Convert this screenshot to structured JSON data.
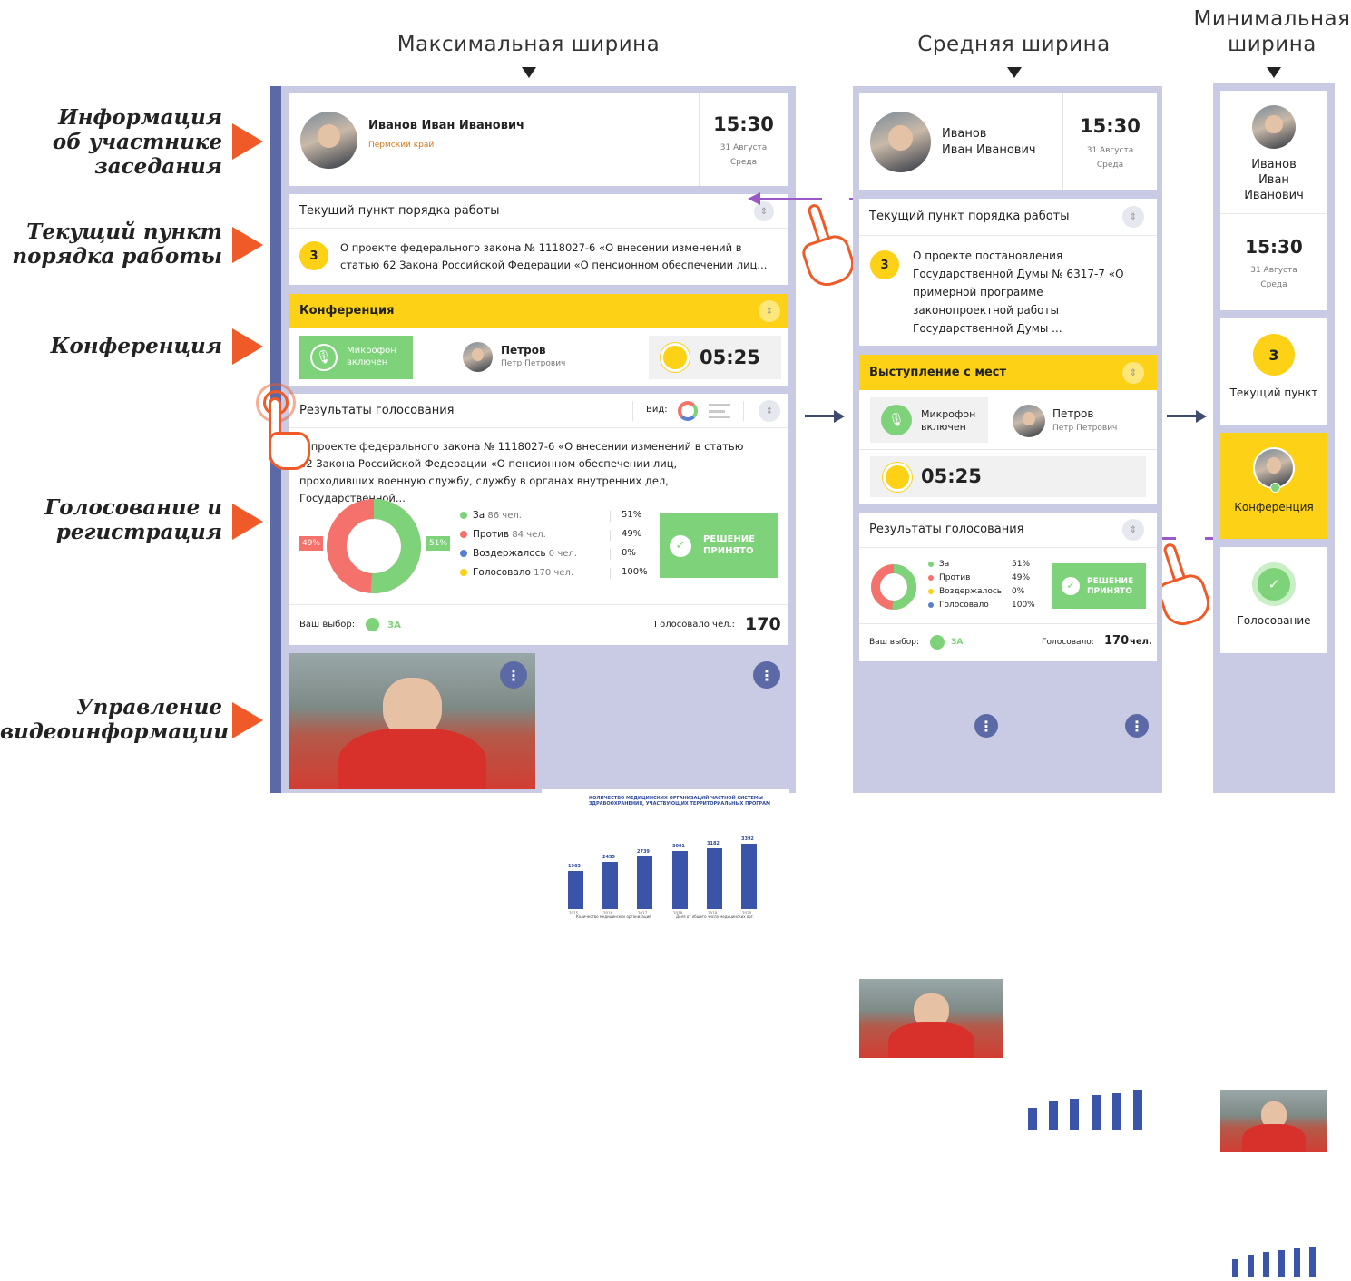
{
  "headers": {
    "max": "Максимальная ширина",
    "mid": "Средняя ширина",
    "min_line1": "Минимальная",
    "min_line2": "ширина"
  },
  "side_labels": {
    "participant": [
      "Информация",
      "об участнике",
      "заседания"
    ],
    "agenda": [
      "Текущий пункт",
      "порядка работы"
    ],
    "conference": [
      "Конференция"
    ],
    "voting": [
      "Голосование и",
      "регистрация"
    ],
    "video": [
      "Управление",
      "видеоинформации"
    ]
  },
  "participant": {
    "full_name": "Иванов Иван Иванович",
    "surname": "Иванов",
    "given": "Иван Иванович",
    "given1": "Иван",
    "given2": "Иванович",
    "region": "Пермский край",
    "time": "15:30",
    "date": "31 Августа",
    "weekday": "Среда"
  },
  "agenda": {
    "title": "Текущий пункт порядка работы",
    "number": "3",
    "text_max": "О проекте федерального закона № 1118027-6 «О внесении изменений в статью 62 Закона Российской Федерации «О пенсионном обеспечении лиц...",
    "text_mid": "О проекте постановления Государственной Думы № 6317-7 «О примерной программе законопроектной работы Государственной Думы ...",
    "short_label": "Текущий пункт"
  },
  "conference": {
    "title_max": "Конференция",
    "title_mid": "Выступление с мест",
    "mic_line1": "Микрофон",
    "mic_line2": "включен",
    "speaker_surname": "Петров",
    "speaker_given": "Петр Петрович",
    "timer": "05:25",
    "short_label": "Конференция"
  },
  "voting": {
    "title": "Результаты голосования",
    "view_label": "Вид:",
    "text": "О проекте федерального закона № 1118027-6 «О внесении изменений в статью 62 Закона Российской Федерации «О пенсионном обеспечении лиц, проходивших военную службу, службу в органах внутренних дел, Государственной...",
    "rows": [
      {
        "label": "За",
        "count": "86",
        "unit": "чел.",
        "pct": "51%",
        "color": "#7ed27a"
      },
      {
        "label": "Против",
        "count": "84",
        "unit": "чел.",
        "pct": "49%",
        "color": "#f4726b"
      },
      {
        "label": "Воздержалось",
        "count": "0",
        "unit": "чел.",
        "pct": "0%",
        "color": "#5b7fd0"
      },
      {
        "label": "Голосовало",
        "count": "170",
        "unit": "чел.",
        "pct": "100%",
        "color": "#fcd116"
      }
    ],
    "mid_rows": [
      {
        "label": "За",
        "pct": "51%",
        "color": "#7ed27a"
      },
      {
        "label": "Против",
        "pct": "49%",
        "color": "#f4726b"
      },
      {
        "label": "Воздержалось",
        "pct": "0%",
        "color": "#fcd116"
      },
      {
        "label": "Голосовало",
        "pct": "100%",
        "color": "#5b7fd0"
      }
    ],
    "donut_for_pct": 51,
    "badge_for": "51%",
    "badge_against": "49%",
    "decision_line1": "РЕШЕНИЕ",
    "decision_line2": "ПРИНЯТО",
    "your_choice_label": "Ваш выбор:",
    "your_choice_value": "ЗА",
    "voted_label_max": "Голосовало чел.:",
    "voted_label_mid": "Голосовало:",
    "voted_total": "170",
    "voted_unit": "чел.",
    "short_label": "Голосование"
  },
  "video": {
    "kebab": "⋮",
    "chart_title_line1": "КОЛИЧЕСТВО МЕДИЦИНСКИХ ОРГАНИЗАЦИЙ ЧАСТНОЙ СИСТЕМЫ",
    "chart_title_line2": "ЗДРАВООХРАНЕНИЯ, УЧАСТВУЮЩИХ ТЕРРИТОРИАЛЬНЫХ ПРОГРАММ",
    "bars": [
      {
        "year": "2015",
        "value": 1963
      },
      {
        "year": "2016",
        "value": 2455
      },
      {
        "year": "2017",
        "value": 2739
      },
      {
        "year": "2018",
        "value": 3001
      },
      {
        "year": "2019",
        "value": 3182
      },
      {
        "year": "2020",
        "value": 3392
      }
    ],
    "legend1": "Количество медицинских организаций",
    "legend2": "Доля от общего числа медицинских орг."
  }
}
